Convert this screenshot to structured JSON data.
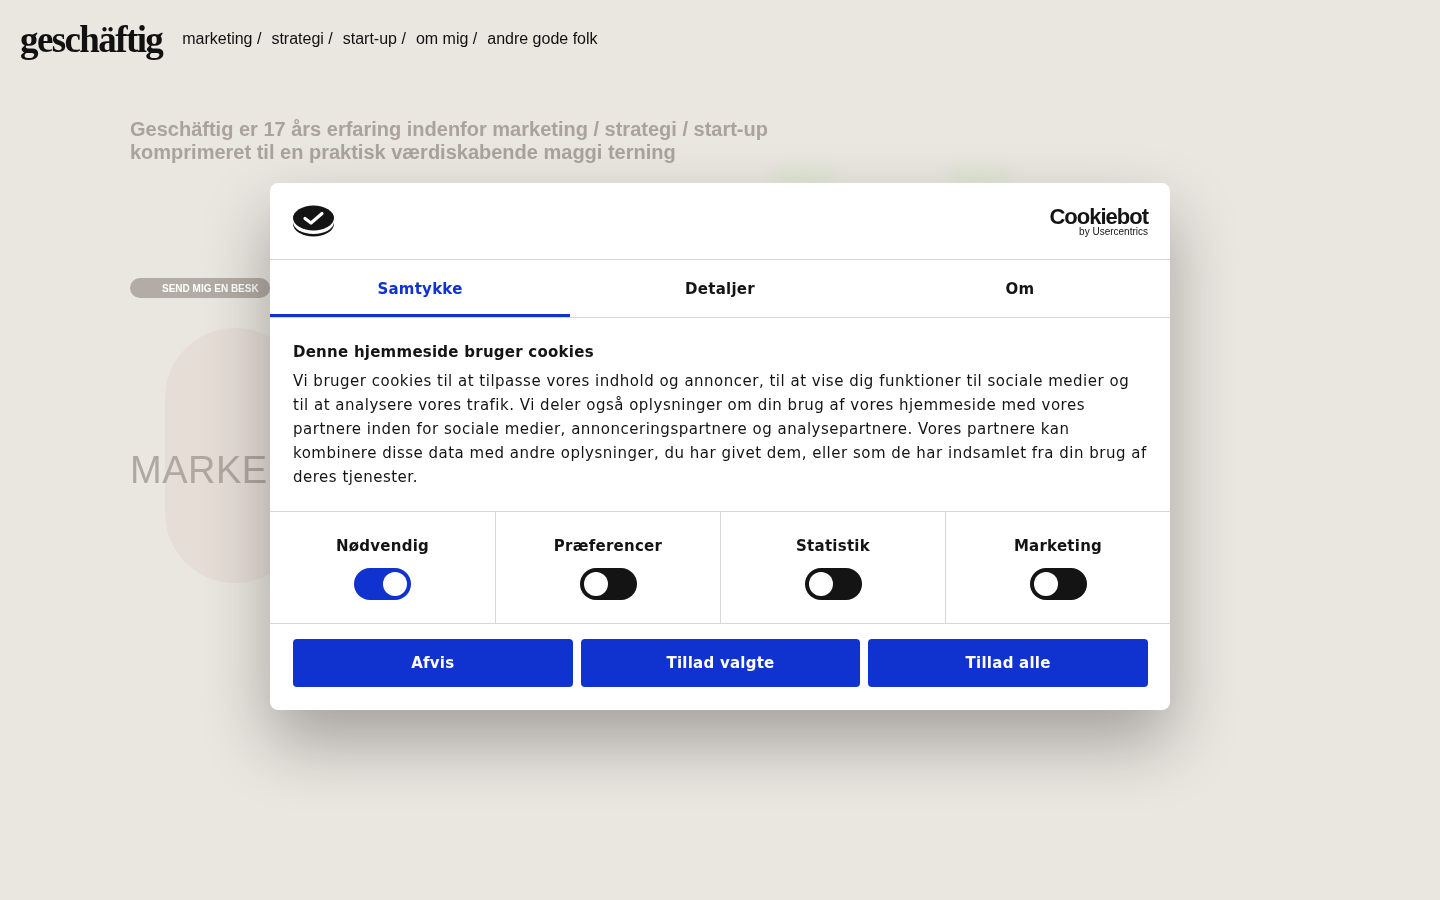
{
  "nav": {
    "logo": "geschäftig",
    "links": [
      "marketing /",
      "strategi /",
      "start-up /",
      "om mig /",
      "andre gode folk"
    ]
  },
  "background": {
    "heading": "Geschäftig er 17 års erfaring indenfor marketing / strategi / start-up komprimeret til en praktisk værdiskabende maggi terning",
    "button": "SEND MIG EN BESK",
    "section_title": "MARKE"
  },
  "cookie_dialog": {
    "brand": {
      "name": "Cookiebot",
      "tagline": "by Usercentrics"
    },
    "tabs": [
      {
        "label": "Samtykke",
        "selected": true
      },
      {
        "label": "Detaljer",
        "selected": false
      },
      {
        "label": "Om",
        "selected": false
      }
    ],
    "title": "Denne hjemmeside bruger cookies",
    "text": "Vi bruger cookies til at tilpasse vores indhold og annoncer, til at vise dig funktioner til sociale medier og til at analysere vores trafik. Vi deler også oplysninger om din brug af vores hjemmeside med vores partnere inden for sociale medier, annonceringspartnere og analysepartnere. Vores partnere kan kombinere disse data med andre oplysninger, du har givet dem, eller som de har indsamlet fra din brug af deres tjenester.",
    "categories": [
      {
        "label": "Nødvendig",
        "on": true
      },
      {
        "label": "Præferencer",
        "on": false
      },
      {
        "label": "Statistik",
        "on": false
      },
      {
        "label": "Marketing",
        "on": false
      }
    ],
    "buttons": [
      "Afvis",
      "Tillad valgte",
      "Tillad alle"
    ]
  }
}
